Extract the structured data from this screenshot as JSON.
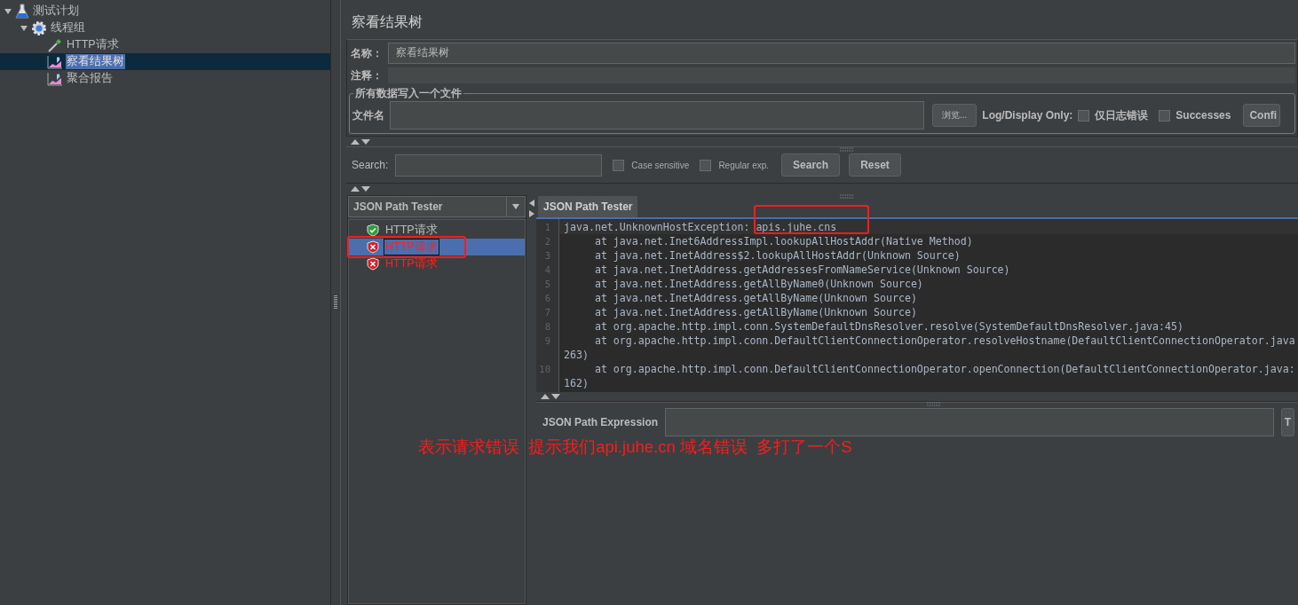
{
  "tree": [
    {
      "label": "测试计划",
      "kind": "plan",
      "expanded": true,
      "selected": false,
      "children": [
        {
          "label": "线程组",
          "kind": "group",
          "expanded": true,
          "selected": false,
          "children": [
            {
              "label": "HTTP请求",
              "kind": "sampler",
              "selected": false
            },
            {
              "label": "察看结果树",
              "kind": "listener",
              "selected": true
            },
            {
              "label": "聚合报告",
              "kind": "listener",
              "selected": false
            }
          ]
        }
      ]
    }
  ],
  "panel": {
    "title": "察看结果树",
    "name_label": "名称：",
    "name_value": "察看结果树",
    "comment_label": "注释：",
    "file_group": {
      "legend": "所有数据写入一个文件",
      "file_label": "文件名",
      "browse_button": "浏览...",
      "log_label": "Log/Display Only:",
      "checks": [
        {
          "label": "仅日志错误",
          "checked": false
        },
        {
          "label": "Successes",
          "checked": false
        }
      ],
      "config_button": "Confi"
    },
    "search": {
      "label": "Search:",
      "options": [
        {
          "label": "Case sensitive",
          "checked": false
        },
        {
          "label": "Regular exp.",
          "checked": false
        }
      ],
      "buttons": [
        "Search",
        "Reset"
      ]
    }
  },
  "renderer": {
    "value": "JSON Path Tester"
  },
  "results": [
    {
      "label": "HTTP请求",
      "passed": true,
      "selected": false
    },
    {
      "label": "HTTP请求",
      "passed": false,
      "selected": true
    },
    {
      "label": "HTTP请求",
      "passed": false,
      "selected": false
    }
  ],
  "tabs": [
    {
      "label": "JSON Path Tester",
      "selected": true
    }
  ],
  "code_lines": [
    {
      "number": "1",
      "text": "java.net.UnknownHostException: apis.juhe.cns"
    },
    {
      "number": "2",
      "text": "\tat java.net.Inet6AddressImpl.lookupAllHostAddr(Native Method)"
    },
    {
      "number": "3",
      "text": "\tat java.net.InetAddress$2.lookupAllHostAddr(Unknown Source)"
    },
    {
      "number": "4",
      "text": "\tat java.net.InetAddress.getAddressesFromNameService(Unknown Source)"
    },
    {
      "number": "5",
      "text": "\tat java.net.InetAddress.getAllByName0(Unknown Source)"
    },
    {
      "number": "6",
      "text": "\tat java.net.InetAddress.getAllByName(Unknown Source)"
    },
    {
      "number": "7",
      "text": "\tat java.net.InetAddress.getAllByName(Unknown Source)"
    },
    {
      "number": "8",
      "text": "\tat org.apache.http.impl.conn.SystemDefaultDnsResolver.resolve(SystemDefaultDnsResolver.java:45)"
    },
    {
      "number": "9",
      "text": "\tat org.apache.http.impl.conn.DefaultClientConnectionOperator.resolveHostname(DefaultClientConnectionOperator.java",
      "continuation": "263)"
    },
    {
      "number": "10",
      "text": "\tat org.apache.http.impl.conn.DefaultClientConnectionOperator.openConnection(DefaultClientConnectionOperator.java:",
      "continuation": "162)"
    }
  ],
  "expression": {
    "label": "JSON Path Expression",
    "button": "T"
  },
  "annotation": {
    "text": "表示请求错误  提示我们api.juhe.cn 域名错误  多打了一个S"
  }
}
